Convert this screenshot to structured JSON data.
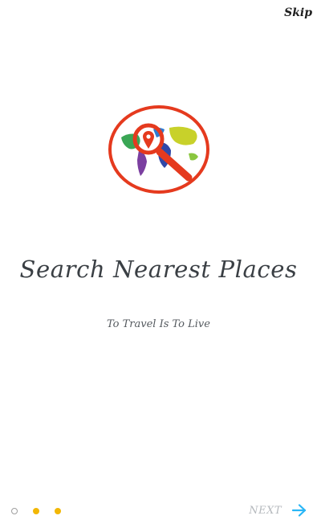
{
  "skip_label": "Skip",
  "title": "Search Nearest Places",
  "subtitle": "To Travel Is To Live",
  "next_label": "NEXT",
  "page_indicator": {
    "total": 3,
    "current": 1
  },
  "colors": {
    "accent": "#f2b705",
    "arrow": "#29b6f6",
    "logo_ring": "#e53a1e",
    "title": "#3a3f44"
  },
  "icons": {
    "logo": "world-map-magnifier-icon",
    "next": "arrow-right-icon"
  }
}
